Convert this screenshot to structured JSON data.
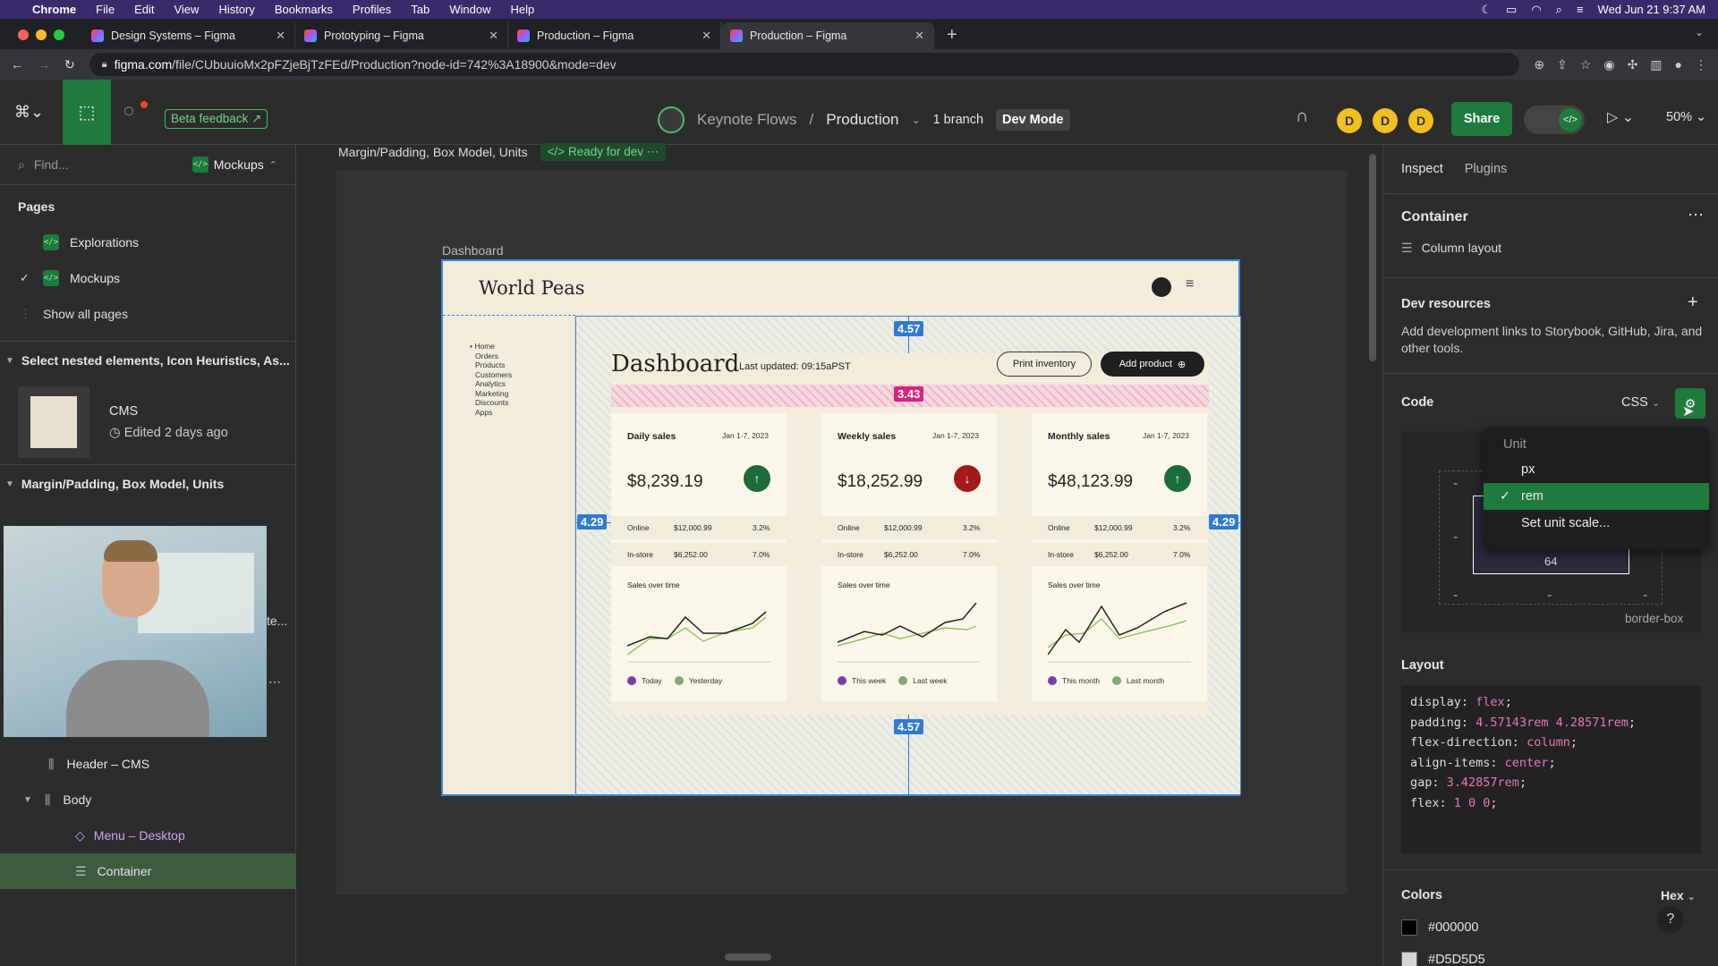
{
  "menubar": {
    "app": "Chrome",
    "items": [
      "File",
      "Edit",
      "View",
      "History",
      "Bookmarks",
      "Profiles",
      "Tab",
      "Window",
      "Help"
    ],
    "datetime": "Wed Jun 21  9:37 AM"
  },
  "tabs": [
    {
      "title": "Design Systems – Figma"
    },
    {
      "title": "Prototyping – Figma"
    },
    {
      "title": "Production – Figma"
    },
    {
      "title": "Production – Figma"
    }
  ],
  "url": {
    "host": "figma.com",
    "path": "/file/CUbuuioMx2pFZjeBjTzFEd/Production?node-id=742%3A18900&mode=dev"
  },
  "toolbar": {
    "beta": "Beta feedback ↗",
    "project": "Keynote Flows",
    "file": "Production",
    "branch": "1 branch",
    "devmode": "Dev Mode",
    "avatars": [
      "D",
      "D",
      "D"
    ],
    "share": "Share",
    "zoom": "50%"
  },
  "left": {
    "find_placeholder": "Find...",
    "page_select": "Mockups",
    "pages_title": "Pages",
    "pages": [
      {
        "name": "Explorations"
      },
      {
        "name": "Mockups"
      }
    ],
    "show_all": "Show all pages",
    "section1": "Select nested elements, Icon Heuristics, As...",
    "cms_title": "CMS",
    "cms_edited": "Edited 2 days ago",
    "section2": "Margin/Padding, Box Model, Units",
    "video_side_text": "te...",
    "tree": [
      "Header – CMS",
      "Body",
      "Menu – Desktop",
      "Container"
    ]
  },
  "canvas": {
    "frame_label": "Margin/Padding, Box Model, Units",
    "ready": "Ready for dev",
    "artboard_label": "Dashboard",
    "site_title": "World Peas",
    "nav": [
      "Home",
      "Orders",
      "Products",
      "Customers",
      "Analytics",
      "Marketing",
      "Discounts",
      "Apps"
    ],
    "dashboard_title": "Dashboard",
    "last_updated": "Last updated: 09:15aPST",
    "print_btn": "Print inventory",
    "add_btn": "Add product",
    "measures": {
      "top": "4.57",
      "pink": "3.43",
      "left": "4.29",
      "right": "4.29",
      "bottom": "4.57"
    },
    "cards": [
      {
        "title": "Daily sales",
        "date": "Jan 1-7, 2023",
        "value": "$8,239.19",
        "trend": "up",
        "online": "$12,000.99",
        "online_pct": "3.2%",
        "instore": "$6,252.00",
        "instore_pct": "7.0%",
        "chart": "Sales over time",
        "legend_a": "Today",
        "legend_b": "Yesterday"
      },
      {
        "title": "Weekly sales",
        "date": "Jan 1-7, 2023",
        "value": "$18,252.99",
        "trend": "down",
        "online": "$12,000.99",
        "online_pct": "3.2%",
        "instore": "$6,252.00",
        "instore_pct": "7.0%",
        "chart": "Sales over time",
        "legend_a": "This week",
        "legend_b": "Last week"
      },
      {
        "title": "Monthly sales",
        "date": "Jan 1-7, 2023",
        "value": "$48,123.99",
        "trend": "up",
        "online": "$12,000.99",
        "online_pct": "3.2%",
        "instore": "$6,252.00",
        "instore_pct": "7.0%",
        "chart": "Sales over time",
        "legend_a": "This month",
        "legend_b": "Last month"
      }
    ],
    "row_labels": {
      "online": "Online",
      "instore": "In-store"
    }
  },
  "right": {
    "tab_inspect": "Inspect",
    "tab_plugins": "Plugins",
    "container": "Container",
    "layout_type": "Column layout",
    "devres": "Dev resources",
    "devres_desc": "Add development links to Storybook, GitHub, Jira, and other tools.",
    "code": "Code",
    "lang": "CSS",
    "unit_menu": {
      "title": "Unit",
      "options": [
        "px",
        "rem",
        "Set unit scale..."
      ],
      "selected": "rem"
    },
    "boxmodel": {
      "bottom_value": "64",
      "sizing": "border-box",
      "dash": "-"
    },
    "layout": "Layout",
    "css": [
      [
        "display",
        "flex"
      ],
      [
        "padding",
        "4.57143rem 4.28571rem"
      ],
      [
        "flex-direction",
        "column"
      ],
      [
        "align-items",
        "center"
      ],
      [
        "gap",
        "3.42857rem"
      ],
      [
        "flex",
        "1 0 0"
      ]
    ],
    "colors": "Colors",
    "color_format": "Hex",
    "swatches": [
      "#000000",
      "#D5D5D5"
    ]
  },
  "colors": {
    "accent": "#1f7a3d",
    "measure": "#2f7bd3",
    "menubar": "#3a2a6a"
  }
}
